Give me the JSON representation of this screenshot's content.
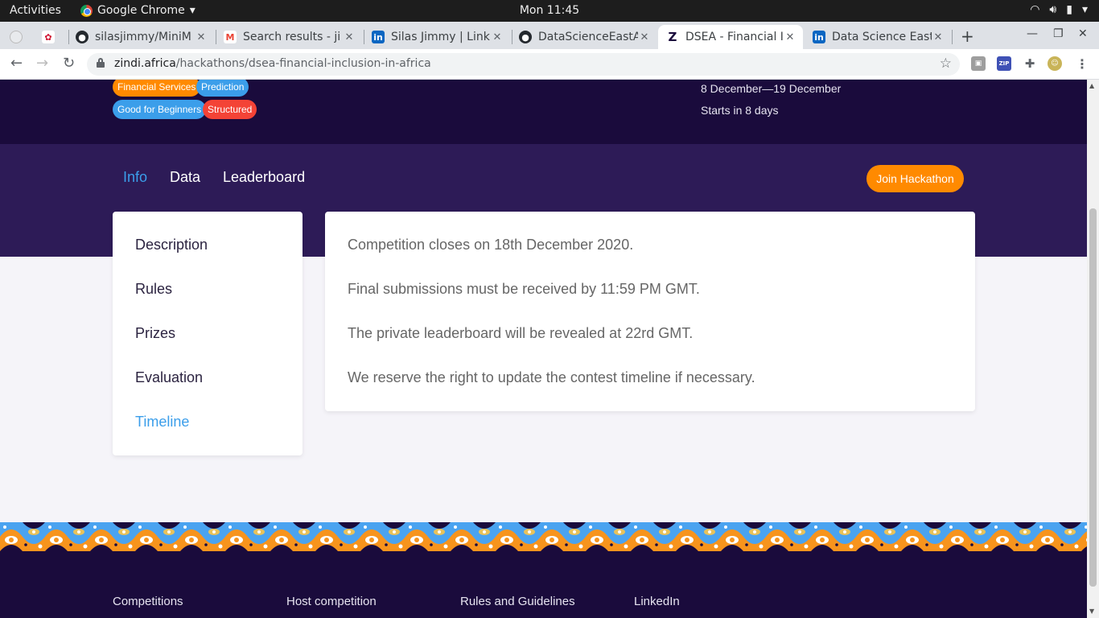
{
  "system_bar": {
    "activities": "Activities",
    "app_name": "Google Chrome",
    "clock": "Mon 11:45"
  },
  "browser": {
    "tabs": [
      {
        "title": ""
      },
      {
        "title": ""
      },
      {
        "title": "silasjimmy/MiniM"
      },
      {
        "title": "Search results - ji"
      },
      {
        "title": "Silas Jimmy | Link"
      },
      {
        "title": "DataScienceEastA"
      },
      {
        "title": "DSEA - Financial I"
      },
      {
        "title": "Data Science East"
      }
    ],
    "url_host": "zindi.africa",
    "url_path": "/hackathons/dsea-financial-inclusion-in-africa",
    "ext_zip": "ZIP"
  },
  "hero": {
    "tags": [
      "Financial Services",
      "Prediction",
      "Good for Beginners",
      "Structured"
    ],
    "date_range": "8 December—19 December",
    "starts_in": "Starts in 8 days"
  },
  "nav": {
    "tabs": [
      "Info",
      "Data",
      "Leaderboard"
    ],
    "join_label": "Join Hackathon"
  },
  "sidebar": {
    "items": [
      "Description",
      "Rules",
      "Prizes",
      "Evaluation",
      "Timeline"
    ]
  },
  "timeline": {
    "lines": [
      "Competition closes on 18th December 2020.",
      "Final submissions must be received by 11:59 PM GMT.",
      "The private leaderboard will be revealed at 22rd GMT.",
      "We reserve the right to update the contest timeline if necessary."
    ]
  },
  "footer": {
    "links": [
      "Competitions",
      "Host competition",
      "Rules and Guidelines",
      "LinkedIn"
    ]
  },
  "colors": {
    "brand_dark": "#1a0b3c",
    "band": "#2d1b57",
    "accent_blue": "#3b9eea",
    "accent_orange": "#ff8a00"
  }
}
